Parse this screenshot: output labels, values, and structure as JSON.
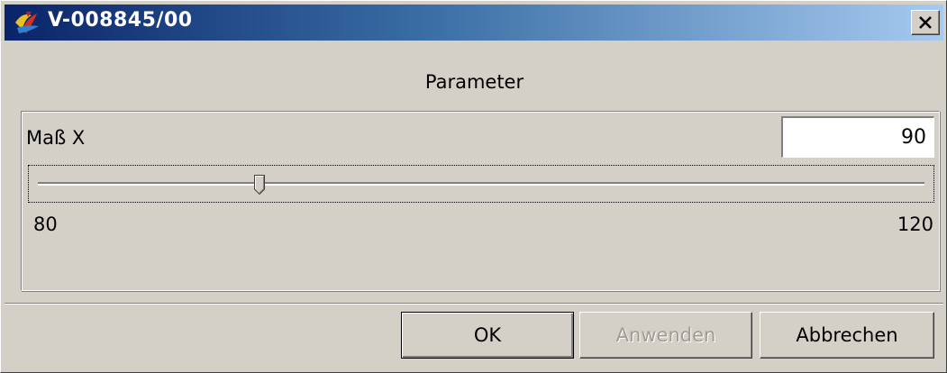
{
  "window": {
    "title": "V-008845/00",
    "close_label": "×"
  },
  "group": {
    "title": "Parameter"
  },
  "parameter": {
    "label": "Maß X",
    "value": "90",
    "slider": {
      "min_label": "80",
      "max_label": "120",
      "min": 80,
      "max": 120,
      "value": 90
    }
  },
  "buttons": {
    "ok_label": "OK",
    "apply_label": "Anwenden",
    "cancel_label": "Abbrechen"
  },
  "colors": {
    "titlebar_start": "#0a246a",
    "titlebar_end": "#a6caf0",
    "face": "#d4d0c8"
  }
}
